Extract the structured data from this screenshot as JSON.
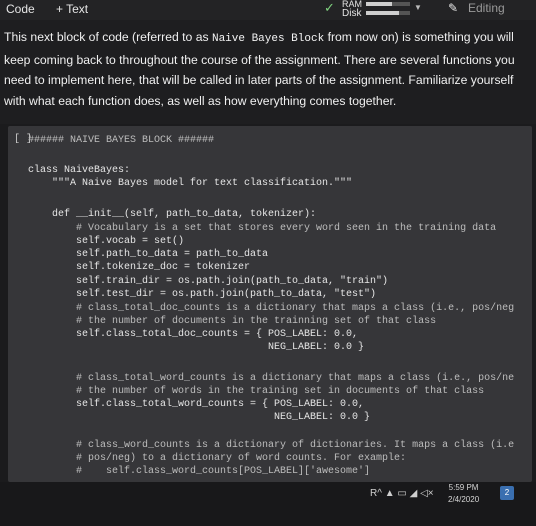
{
  "toolbar": {
    "code_label": "Code",
    "text_label": "+ Text",
    "ram_label": "RAM",
    "disk_label": "Disk",
    "ram_usage": 0.6,
    "disk_usage": 0.75,
    "editing_label": "Editing"
  },
  "text_cell": {
    "part1": "This next block of code (referred to as ",
    "code": "Naive Bayes Block",
    "part2": " from now on) is something you will keep coming back to throughout the course of the assignment. There are several functions you need to implement here, that will be called in later parts of the assignment. Familiarize yourself with what each function does, as well as how everything comes together."
  },
  "code_cell": {
    "run_marker": "[ ]",
    "lines": [
      "###### NAIVE BAYES BLOCK ######",
      "",
      "class NaiveBayes:",
      "    \"\"\"A Naive Bayes model for text classification.\"\"\"",
      "",
      "    def __init__(self, path_to_data, tokenizer):",
      "        # Vocabulary is a set that stores every word seen in the training data",
      "        self.vocab = set()",
      "        self.path_to_data = path_to_data",
      "        self.tokenize_doc = tokenizer",
      "        self.train_dir = os.path.join(path_to_data, \"train\")",
      "        self.test_dir = os.path.join(path_to_data, \"test\")",
      "        # class_total_doc_counts is a dictionary that maps a class (i.e., pos/neg",
      "        # the number of documents in the trainning set of that class",
      "        self.class_total_doc_counts = { POS_LABEL: 0.0,",
      "                                        NEG_LABEL: 0.0 }",
      "",
      "        # class_total_word_counts is a dictionary that maps a class (i.e., pos/ne",
      "        # the number of words in the training set in documents of that class",
      "        self.class_total_word_counts = { POS_LABEL: 0.0,",
      "                                         NEG_LABEL: 0.0 }",
      "",
      "        # class_word_counts is a dictionary of dictionaries. It maps a class (i.e",
      "        # pos/neg) to a dictionary of word counts. For example:",
      "        #    self.class_word_counts[POS_LABEL]['awesome']"
    ]
  },
  "taskbar": {
    "time": "5:59 PM",
    "date": "2/4/2020",
    "notifications": "2",
    "tray": "R^ ▲ ▭ ◢ ◁×"
  }
}
